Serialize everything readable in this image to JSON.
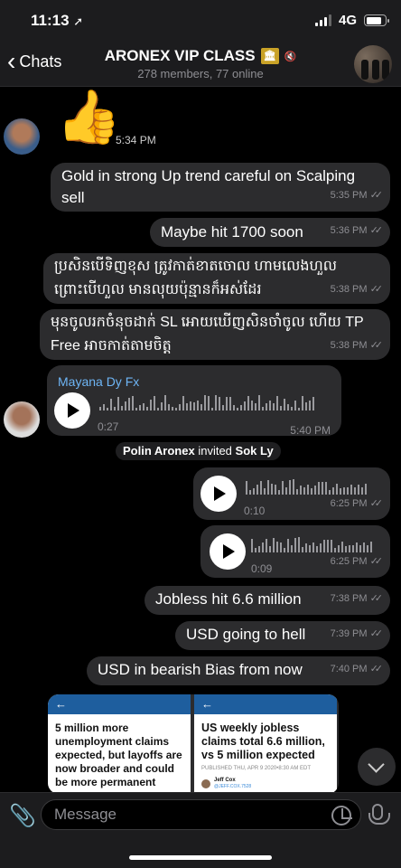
{
  "status": {
    "time": "11:13",
    "location_icon": "location-arrow-icon",
    "network": "4G",
    "battery_level": 0.8
  },
  "header": {
    "back_label": "Chats",
    "title": "ARONEX VIP CLASS",
    "title_icon": "bank-emoji-icon",
    "subtitle": "278 members, 77 online"
  },
  "messages": {
    "thumbs": {
      "emoji": "👍",
      "time": "5:34 PM"
    },
    "m1": {
      "text": "Gold in strong Up trend careful on Scalping sell",
      "time": "5:35 PM"
    },
    "m2": {
      "text": "Maybe hit 1700 soon",
      "time": "5:36 PM"
    },
    "m3": {
      "text": "ប្រសិនបើទិញខុស ត្រូវកាត់ខាតចោល ហាមលេងហួល ព្រោះបើហួល មានលុយប៉ុន្មានក៏អស់ដែរ",
      "time": "5:38 PM"
    },
    "m4": {
      "text": "មុនចូលរកចំនុចដាក់ SL អោយឃើញសិនចាំចូល ហើយ TP Free អាចកាត់តាមចិត្ត",
      "time": "5:38 PM"
    },
    "voice_in": {
      "sender": "Mayana Dy Fx",
      "duration": "0:27",
      "time": "5:40 PM"
    },
    "system": {
      "actor": "Polin Aronex",
      "action": "invited",
      "target": "Sok Ly"
    },
    "voice_out1": {
      "duration": "0:10",
      "time": "6:25 PM"
    },
    "voice_out2": {
      "duration": "0:09",
      "time": "6:25 PM"
    },
    "m5": {
      "text": "Jobless hit 6.6 million",
      "time": "7:38 PM"
    },
    "m6": {
      "text": "USD going to hell",
      "time": "7:39 PM"
    },
    "m7": {
      "text": "USD in bearish Bias from now",
      "time": "7:40 PM"
    }
  },
  "preview": {
    "back_arrow": "←",
    "left_headline": "5 million more unemployment claims expected, but layoffs are now broader and could be more permanent",
    "right_headline": "US weekly jobless claims total 6.6 million, vs 5 million expected",
    "right_published": "PUBLISHED THU, APR 9 2020•8:30 AM EDT",
    "right_author": "Jeff Cox",
    "right_handle": "@JEFF.COX.7528"
  },
  "input": {
    "placeholder": "Message"
  },
  "colors": {
    "background": "#000000",
    "bubble": "#2c2c2e",
    "accent": "#6eb5f5"
  }
}
